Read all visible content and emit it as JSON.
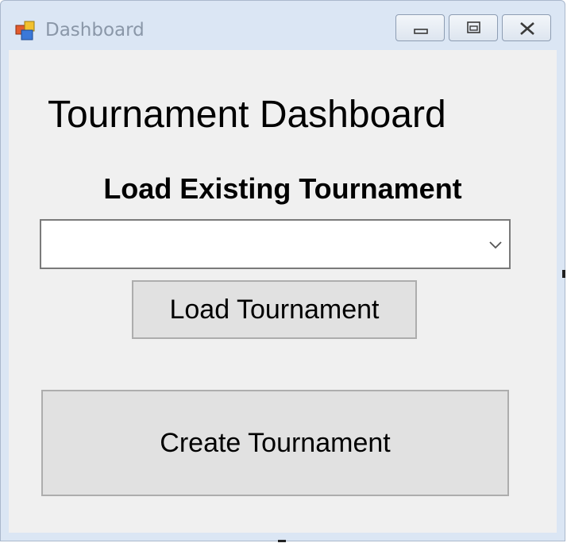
{
  "window": {
    "title": "Dashboard",
    "icon": "app-form-icon",
    "controls": {
      "minimize": "minimize-icon",
      "maximize": "maximize-icon",
      "close": "close-icon"
    }
  },
  "main": {
    "heading": "Tournament Dashboard",
    "subheading": "Load Existing Tournament",
    "tournament_select": {
      "value": "",
      "arrow_icon": "chevron-down-icon"
    },
    "load_button_label": "Load Tournament",
    "create_button_label": "Create Tournament"
  },
  "colors": {
    "client_background": "#f0f0f0",
    "button_background": "#e1e1e1",
    "title_text": "#8a97a8"
  }
}
